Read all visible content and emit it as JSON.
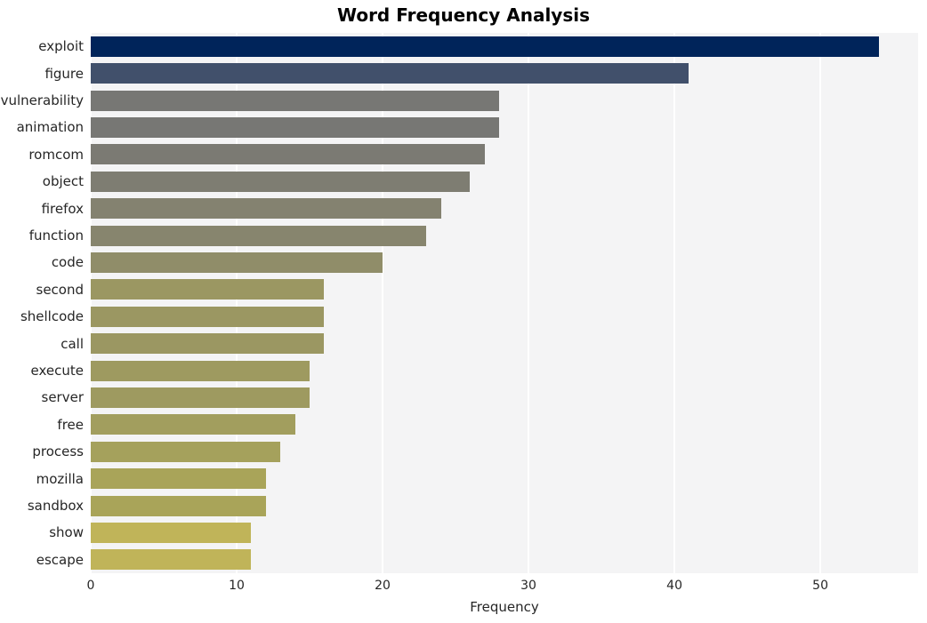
{
  "chart_data": {
    "type": "bar",
    "orientation": "horizontal",
    "title": "Word Frequency Analysis",
    "xlabel": "Frequency",
    "ylabel": "",
    "categories": [
      "exploit",
      "figure",
      "vulnerability",
      "animation",
      "romcom",
      "object",
      "firefox",
      "function",
      "code",
      "second",
      "shellcode",
      "call",
      "execute",
      "server",
      "free",
      "process",
      "mozilla",
      "sandbox",
      "show",
      "escape"
    ],
    "values": [
      54,
      41,
      28,
      28,
      27,
      26,
      24,
      23,
      20,
      16,
      16,
      16,
      15,
      15,
      14,
      13,
      12,
      12,
      11,
      11
    ],
    "bar_colors": [
      "#00245a",
      "#41506b",
      "#777774",
      "#777774",
      "#7b7a73",
      "#7e7d72",
      "#848270",
      "#87856e",
      "#908d69",
      "#9b9762",
      "#9b9762",
      "#9b9762",
      "#9e9a60",
      "#9e9a60",
      "#a29e5e",
      "#a5a15c",
      "#a9a459",
      "#a9a459",
      "#c0b459",
      "#c0b459"
    ],
    "xlim": [
      0,
      56.7
    ],
    "xticks": [
      0,
      10,
      20,
      30,
      40,
      50
    ],
    "xtick_labels": [
      "0",
      "10",
      "20",
      "30",
      "40",
      "50"
    ],
    "grid": "vertical-white-on-light",
    "legend": "none",
    "plot_background": "#f4f4f5",
    "figure_background": "#ffffff",
    "style": "whitegrid",
    "colormap": "cividis"
  }
}
